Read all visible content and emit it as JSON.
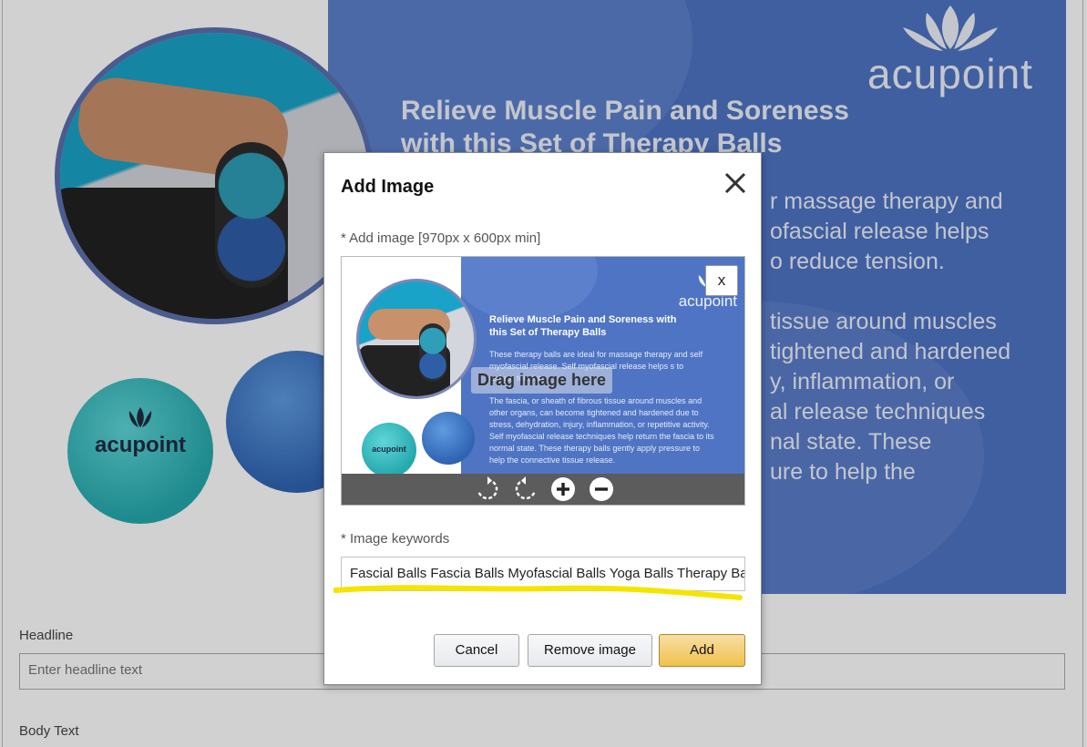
{
  "background": {
    "promo": {
      "logo_text": "acupoint",
      "headline_line1": "Relieve Muscle Pain and Soreness",
      "headline_line2": "with this Set of Therapy Balls",
      "para_lines": [
        "r massage therapy and",
        "ofascial release helps",
        "o reduce tension.",
        "",
        "tissue around muscles",
        "tightened and hardened",
        "y, inflammation, or",
        "al release techniques",
        "nal state. These",
        "ure to help the"
      ]
    },
    "ball_logo_text": "acupoint",
    "headline": {
      "label": "Headline",
      "placeholder": "Enter headline text"
    },
    "body_text": {
      "label": "Body Text"
    }
  },
  "modal": {
    "title": "Add Image",
    "close_icon": "close-icon",
    "image_label": "* Add image [970px x 600px min]",
    "dropzone": {
      "remove_label": "x",
      "drag_text": "Drag image here",
      "thumbnail": {
        "logo_text": "acupoint",
        "ball_text": "acupoint",
        "headline": "Relieve Muscle Pain and Soreness with this Set of Therapy Balls",
        "para1": "These therapy balls are ideal for massage therapy and self myofascial release. Self myofascial release helps s to reduce tension.",
        "para2": "The fascia, or sheath of fibrous tissue around muscles and other organs, can become tightened and hardened due to stress, dehydration, injury, inflammation, or repetitive activity. Self myofascial release techniques help return the fascia to its normal state. These therapy balls gently apply pressure to help the connective tissue release."
      },
      "tools": [
        {
          "name": "rotate-clockwise-icon"
        },
        {
          "name": "rotate-counterclockwise-icon"
        },
        {
          "name": "zoom-in-icon"
        },
        {
          "name": "zoom-out-icon"
        }
      ]
    },
    "keywords_label": "* Image keywords",
    "keywords_value": "Fascial Balls Fascia Balls Myofascial Balls Yoga Balls Therapy Balls",
    "highlight_color": "#f5e400",
    "buttons": {
      "cancel": "Cancel",
      "remove": "Remove image",
      "add": "Add"
    },
    "accent_color": "#f0c14b"
  }
}
